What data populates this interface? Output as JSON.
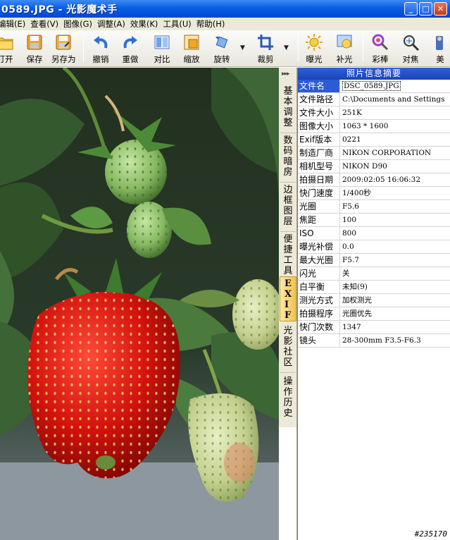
{
  "window": {
    "title": "0589.JPG - 光影魔术手",
    "buttons": {
      "minimize": "_",
      "maximize": "□",
      "close": "✕"
    }
  },
  "menu": [
    "编辑(E)",
    "查看(V)",
    "图像(G)",
    "调整(A)",
    "效果(K)",
    "工具(U)",
    "帮助(H)"
  ],
  "toolbar": [
    {
      "name": "open",
      "label": "打开",
      "icon": "folder-icon"
    },
    {
      "name": "save",
      "label": "保存",
      "icon": "save-icon"
    },
    {
      "name": "saveas",
      "label": "另存为",
      "icon": "save-as-icon"
    },
    {
      "name": "undo",
      "label": "撤销",
      "icon": "undo-icon"
    },
    {
      "name": "redo",
      "label": "重做",
      "icon": "redo-icon"
    },
    {
      "name": "compare",
      "label": "对比",
      "icon": "compare-icon"
    },
    {
      "name": "resize",
      "label": "缩放",
      "icon": "resize-icon"
    },
    {
      "name": "rotate",
      "label": "旋转",
      "icon": "rotate-icon"
    },
    {
      "name": "crop",
      "label": "裁剪",
      "icon": "crop-icon"
    },
    {
      "name": "exposure",
      "label": "曝光",
      "icon": "exposure-icon"
    },
    {
      "name": "fill-light",
      "label": "补光",
      "icon": "fill-light-icon"
    },
    {
      "name": "magic-wand",
      "label": "彩棒",
      "icon": "magic-wand-icon"
    },
    {
      "name": "focus",
      "label": "对焦",
      "icon": "focus-icon"
    },
    {
      "name": "beauty",
      "label": "美",
      "icon": "beauty-icon"
    }
  ],
  "side_tabs": [
    {
      "label": "基本调整",
      "active": false
    },
    {
      "label": "数码暗房",
      "active": false
    },
    {
      "label": "边框图层",
      "active": false
    },
    {
      "label": "便捷工具",
      "active": false
    },
    {
      "label": "EXIF",
      "active": true
    },
    {
      "label": "光影社区",
      "active": false
    },
    {
      "label": "操作历史",
      "active": false
    }
  ],
  "side_tabs_top": "▸▸▸",
  "panel": {
    "title": "照片信息摘要",
    "rows": [
      {
        "key": "文件名",
        "value": "DSC_0589.JPG"
      },
      {
        "key": "文件路径",
        "value": "C:\\Documents and Settings"
      },
      {
        "key": "文件大小",
        "value": "251K"
      },
      {
        "key": "图像大小",
        "value": "1063 * 1600"
      },
      {
        "key": "Exif版本",
        "value": "0221"
      },
      {
        "key": "制造厂商",
        "value": "NIKON CORPORATION"
      },
      {
        "key": "相机型号",
        "value": "NIKON D90"
      },
      {
        "key": "拍摄日期",
        "value": "2009:02:05 16:06:32"
      },
      {
        "key": "快门速度",
        "value": "1/400秒"
      },
      {
        "key": "光圈",
        "value": "F5.6"
      },
      {
        "key": "焦距",
        "value": "100"
      },
      {
        "key": "ISO",
        "value": "800"
      },
      {
        "key": "曝光补偿",
        "value": "0.0"
      },
      {
        "key": "最大光圈",
        "value": "F5.7"
      },
      {
        "key": "闪光",
        "value": "关"
      },
      {
        "key": "白平衡",
        "value": "未知(9)"
      },
      {
        "key": "测光方式",
        "value": "加权测光"
      },
      {
        "key": "拍摄程序",
        "value": "光圈优先"
      },
      {
        "key": "快门次数",
        "value": "1347"
      },
      {
        "key": "镜头",
        "value": "28-300mm F3.5-F6.3"
      }
    ]
  },
  "watermark": "#235170"
}
